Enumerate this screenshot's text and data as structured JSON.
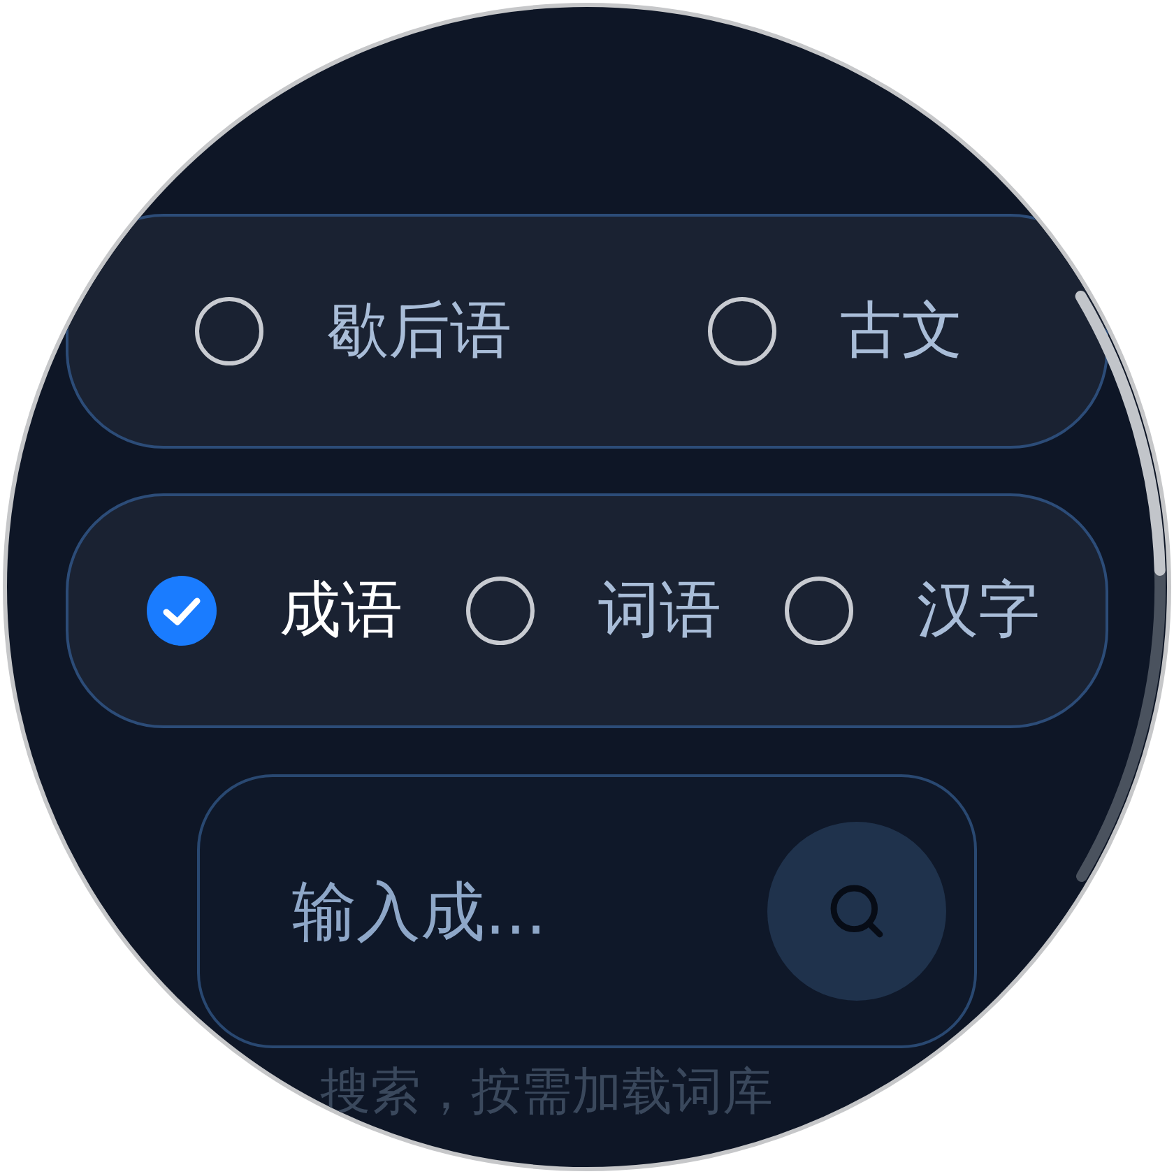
{
  "option_groups": [
    {
      "options": [
        {
          "label": "歇后语",
          "selected": false
        },
        {
          "label": "古文",
          "selected": false
        }
      ]
    },
    {
      "options": [
        {
          "label": "成语",
          "selected": true
        },
        {
          "label": "词语",
          "selected": false
        },
        {
          "label": "汉字",
          "selected": false
        }
      ]
    }
  ],
  "search": {
    "placeholder": "输入成..."
  },
  "hint": "搜索，按需加载词库"
}
